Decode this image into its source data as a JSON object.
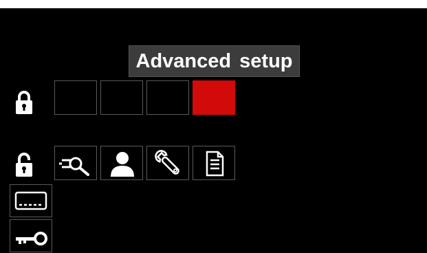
{
  "screen": {
    "title": "Advanced setup"
  },
  "colors": {
    "background": "#000000",
    "title_box": "#3c3c3c",
    "selected_slot": "#d20a0a",
    "slot_border": "#5a5a5a",
    "icon": "#ffffff"
  },
  "locked_row": {
    "icon": "lock-closed-icon",
    "slots": [
      {
        "state": "empty"
      },
      {
        "state": "empty"
      },
      {
        "state": "empty"
      },
      {
        "state": "selected"
      }
    ]
  },
  "unlocked_row": {
    "icon": "lock-open-icon",
    "items": [
      {
        "icon": "inspect-icon"
      },
      {
        "icon": "user-icon"
      },
      {
        "icon": "wrench-icon"
      },
      {
        "icon": "document-icon"
      }
    ]
  },
  "side_menu": {
    "items": [
      {
        "icon": "display-icon"
      },
      {
        "icon": "key-icon"
      }
    ]
  }
}
